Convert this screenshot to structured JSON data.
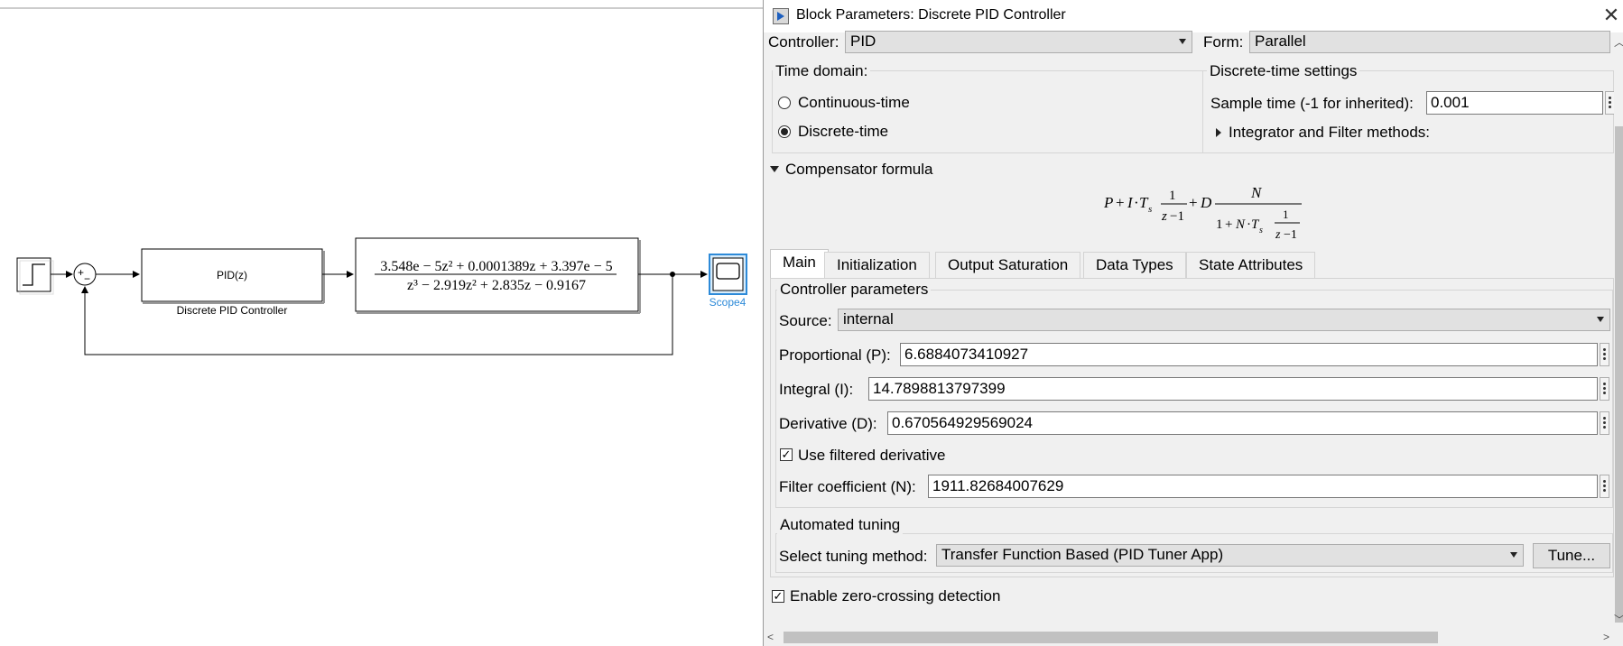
{
  "canvas": {
    "pid_block_label": "PID(z)",
    "pid_block_caption": "Discrete PID Controller",
    "tf_numerator": "3.548e − 5z² + 0.0001389z + 3.397e − 5",
    "tf_denominator": "z³ − 2.919z² + 2.835z − 0.9167",
    "sum_plus": "+",
    "sum_minus": "−",
    "scope_label": "Scope4"
  },
  "dialog": {
    "title": "Block Parameters: Discrete PID Controller",
    "controller_label": "Controller:",
    "controller_value": "PID",
    "form_label": "Form:",
    "form_value": "Parallel",
    "time_domain": {
      "legend": "Time domain:",
      "continuous": "Continuous-time",
      "discrete": "Discrete-time",
      "selected": "Discrete-time"
    },
    "discrete_settings": {
      "legend": "Discrete-time settings",
      "sample_time_label": "Sample time (-1 for inherited):",
      "sample_time_value": "0.001",
      "integrator_methods": "Integrator and Filter methods:"
    },
    "compensator": {
      "label": "Compensator formula"
    },
    "tabs": [
      "Main",
      "Initialization",
      "Output Saturation",
      "Data Types",
      "State Attributes"
    ],
    "active_tab": "Main",
    "controller_params": {
      "legend": "Controller parameters",
      "source_label": "Source:",
      "source_value": "internal",
      "p_label": "Proportional (P):",
      "p_value": "6.6884073410927",
      "i_label": "Integral (I):",
      "i_value": "14.7898813797399",
      "d_label": "Derivative (D):",
      "d_value": "0.670564929569024",
      "filtered_label": "Use filtered derivative",
      "filtered_checked": true,
      "n_label": "Filter coefficient (N):",
      "n_value": "1911.82684007629"
    },
    "tuning": {
      "legend": "Automated tuning",
      "method_label": "Select tuning method:",
      "method_value": "Transfer Function Based (PID Tuner App)",
      "tune_button": "Tune..."
    },
    "zero_crossing_label": "Enable zero-crossing detection",
    "zero_crossing_checked": true
  }
}
